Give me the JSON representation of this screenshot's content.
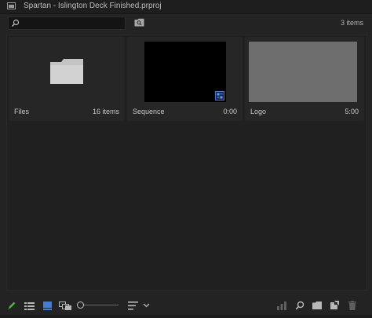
{
  "window": {
    "title": "Spartan - Islington Deck Finished.prproj"
  },
  "search": {
    "value": "",
    "placeholder": ""
  },
  "item_count": "3 items",
  "items": [
    {
      "name": "Files",
      "meta": "16 items",
      "type": "bin"
    },
    {
      "name": "Sequence",
      "meta": "0:00",
      "type": "sequence"
    },
    {
      "name": "Logo",
      "meta": "5:00",
      "type": "still"
    }
  ],
  "colors": {
    "accent_green": "#4fb146",
    "accent_blue": "#3f7fd8",
    "panel_bg": "#232323"
  },
  "toolbar": {
    "icons": [
      "pencil-icon",
      "list-view-icon",
      "icon-view-icon",
      "freeform-view-icon",
      "zoom-slider",
      "sort-icons-menu",
      "automate-to-sequence-icon",
      "find-icon",
      "new-bin-icon",
      "new-item-icon",
      "trash-icon"
    ]
  }
}
